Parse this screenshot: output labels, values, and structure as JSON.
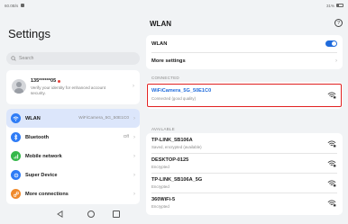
{
  "status_bar": {
    "left_text": "60.0B/s",
    "right_text": "31%"
  },
  "left": {
    "title": "Settings",
    "search": {
      "placeholder": "Search"
    },
    "account": {
      "name": "135******05",
      "subtitle": "Verify your identity for enhanced account security."
    },
    "menu": [
      {
        "label": "WLAN",
        "value": "WiFiCamera_5G_50E1C0",
        "icon": "wifi-icon",
        "color": "#2f7cf6"
      },
      {
        "label": "Bluetooth",
        "value": "Off",
        "icon": "bluetooth-icon",
        "color": "#2f7cf6"
      },
      {
        "label": "Mobile network",
        "value": "",
        "icon": "mobile-network-icon",
        "color": "#35b84a"
      },
      {
        "label": "Super Device",
        "value": "",
        "icon": "super-device-icon",
        "color": "#2f7cf6"
      },
      {
        "label": "More connections",
        "value": "",
        "icon": "link-icon",
        "color": "#f08a2c"
      }
    ]
  },
  "right": {
    "title": "WLAN",
    "wlan_toggle_label": "WLAN",
    "more_settings_label": "More settings",
    "connected_section": "CONNECTED",
    "connected": {
      "name": "WiFiCamera_5G_50E1C0",
      "status": "Connected (good quality)"
    },
    "available_section": "AVAILABLE",
    "available": [
      {
        "name": "TP-LINK_5B106A",
        "status": "Saved, encrypted (available)"
      },
      {
        "name": "DESKTOP-0125",
        "status": "Encrypted"
      },
      {
        "name": "TP-LINK_5B106A_5G",
        "status": "Encrypted"
      },
      {
        "name": "360WiFi-5",
        "status": "Encrypted"
      }
    ]
  },
  "colors": {
    "accent": "#1f6bdc",
    "highlight": "#e02020"
  }
}
